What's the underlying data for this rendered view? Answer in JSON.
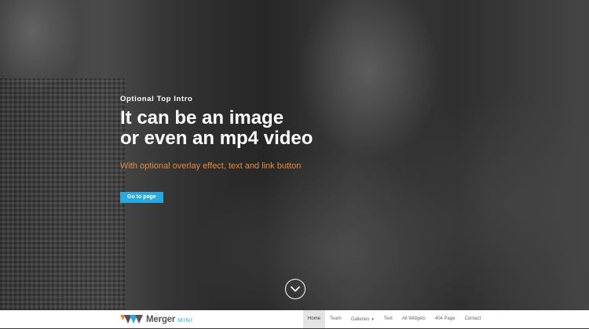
{
  "hero": {
    "intro": "Optional Top Intro",
    "headline_line1": "It can be an image",
    "headline_line2": "or even an mp4 video",
    "subline": "With optional overlay effect, text and link button",
    "button_label": "Go to page",
    "scroll_icon": "chevron-down-icon"
  },
  "brand": {
    "name": "Merger",
    "suffix": "MINI",
    "logo_icon": "merger-logo-icon"
  },
  "nav": {
    "items": [
      {
        "label": "Home",
        "active": true
      },
      {
        "label": "Team"
      },
      {
        "label": "Galleries",
        "dropdown": true
      },
      {
        "label": "Text"
      },
      {
        "label": "All Widgets"
      },
      {
        "label": "404 Page"
      },
      {
        "label": "Contact"
      }
    ]
  },
  "colors": {
    "accent_blue": "#29a9df",
    "accent_orange": "#e8893d",
    "navbar_bg": "#ffffff",
    "active_item_bg": "#e4e4e4"
  }
}
